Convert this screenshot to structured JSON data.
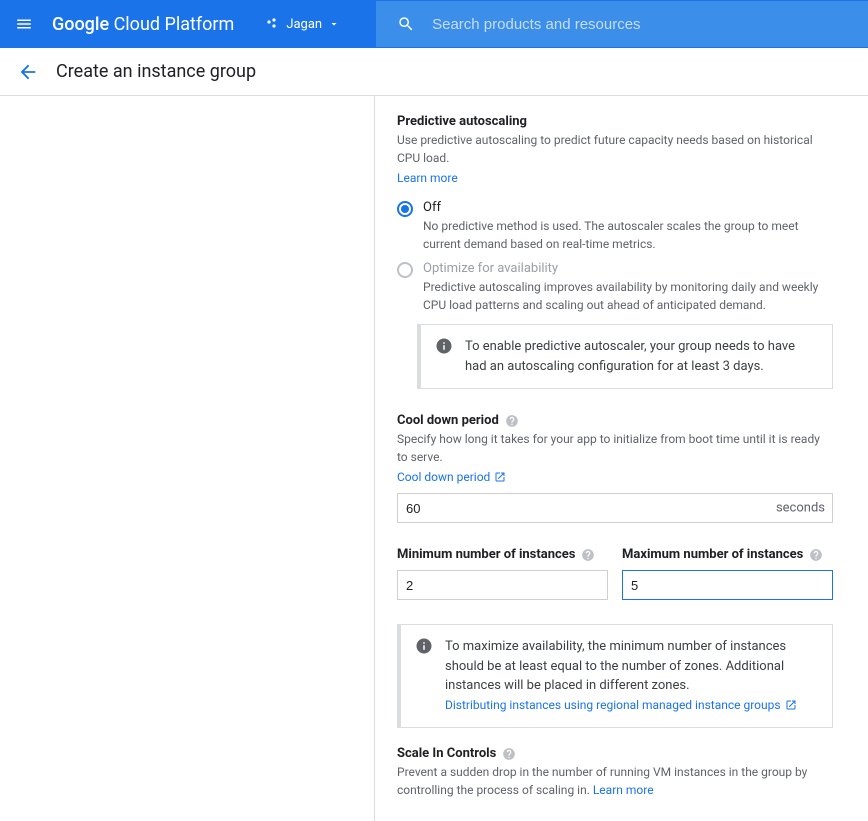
{
  "header": {
    "logo_google": "Google",
    "logo_rest": " Cloud Platform",
    "project_name": "Jagan",
    "search_placeholder": "Search products and resources"
  },
  "page": {
    "title": "Create an instance group"
  },
  "predictive": {
    "heading": "Predictive autoscaling",
    "desc": "Use predictive autoscaling to predict future capacity needs based on historical CPU load.",
    "learn_more": "Learn more",
    "off_label": "Off",
    "off_desc": "No predictive method is used. The autoscaler scales the group to meet current demand based on real-time metrics.",
    "optimize_label": "Optimize for availability",
    "optimize_desc": "Predictive autoscaling improves availability by monitoring daily and weekly CPU load patterns and scaling out ahead of anticipated demand.",
    "info_text": "To enable predictive autoscaler, your group needs to have had an autoscaling configuration for at least 3 days."
  },
  "cooldown": {
    "label": "Cool down period",
    "desc": "Specify how long it takes for your app to initialize from boot time until it is ready to serve.",
    "link": "Cool down period",
    "value": "60",
    "suffix": "seconds"
  },
  "min": {
    "label": "Minimum number of instances",
    "value": "2"
  },
  "max": {
    "label": "Maximum number of instances",
    "value": "5"
  },
  "availability_info": {
    "text": "To maximize availability, the minimum number of instances should be at least equal to the number of zones. Additional instances will be placed in different zones.",
    "link": "Distributing instances using regional managed instance groups"
  },
  "scalein": {
    "label": "Scale In Controls",
    "desc": "Prevent a sudden drop in the number of running VM instances in the group by controlling the process of scaling in. ",
    "learn_more": "Learn more"
  }
}
